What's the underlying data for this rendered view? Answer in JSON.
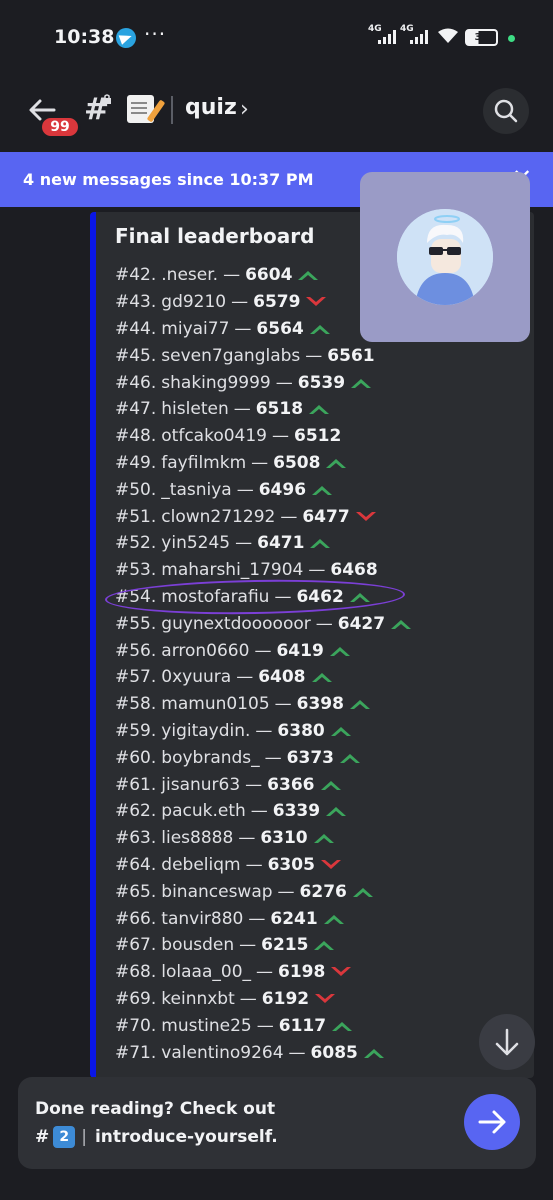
{
  "status_bar": {
    "time": "10:38",
    "dots": "···",
    "net1": "4G",
    "net2": "4G",
    "battery": "39"
  },
  "header": {
    "badge": "99",
    "hash": "#",
    "channel_name": "quiz",
    "chevron": "›"
  },
  "new_messages": {
    "text": "4 new messages since 10:37 PM",
    "close": "✕"
  },
  "embed": {
    "title": "Final leaderboard",
    "rows": [
      {
        "rank": "#42.",
        "name": ".neser.",
        "score": "6604",
        "trend": "up"
      },
      {
        "rank": "#43.",
        "name": "gd9210",
        "score": "6579",
        "trend": "down"
      },
      {
        "rank": "#44.",
        "name": "miyai77",
        "score": "6564",
        "trend": "up"
      },
      {
        "rank": "#45.",
        "name": "seven7ganglabs",
        "score": "6561",
        "trend": ""
      },
      {
        "rank": "#46.",
        "name": "shaking9999",
        "score": "6539",
        "trend": "up"
      },
      {
        "rank": "#47.",
        "name": "hisleten",
        "score": "6518",
        "trend": "up"
      },
      {
        "rank": "#48.",
        "name": "otfcako0419",
        "score": "6512",
        "trend": ""
      },
      {
        "rank": "#49.",
        "name": "fayfilmkm",
        "score": "6508",
        "trend": "up"
      },
      {
        "rank": "#50.",
        "name": "_tasniya",
        "score": "6496",
        "trend": "up"
      },
      {
        "rank": "#51.",
        "name": "clown271292",
        "score": "6477",
        "trend": "down"
      },
      {
        "rank": "#52.",
        "name": "yin5245",
        "score": "6471",
        "trend": "up"
      },
      {
        "rank": "#53.",
        "name": "maharshi_17904",
        "score": "6468",
        "trend": ""
      },
      {
        "rank": "#54.",
        "name": "mostofarafiu",
        "score": "6462",
        "trend": "up"
      },
      {
        "rank": "#55.",
        "name": "guynextdoooooor",
        "score": "6427",
        "trend": "up"
      },
      {
        "rank": "#56.",
        "name": "arron0660",
        "score": "6419",
        "trend": "up"
      },
      {
        "rank": "#57.",
        "name": "0xyuura",
        "score": "6408",
        "trend": "up"
      },
      {
        "rank": "#58.",
        "name": "mamun0105",
        "score": "6398",
        "trend": "up"
      },
      {
        "rank": "#59.",
        "name": "yigitaydin.",
        "score": "6380",
        "trend": "up"
      },
      {
        "rank": "#60.",
        "name": "boybrands_",
        "score": "6373",
        "trend": "up"
      },
      {
        "rank": "#61.",
        "name": "jisanur63",
        "score": "6366",
        "trend": "up"
      },
      {
        "rank": "#62.",
        "name": "pacuk.eth",
        "score": "6339",
        "trend": "up"
      },
      {
        "rank": "#63.",
        "name": "lies8888",
        "score": "6310",
        "trend": "up"
      },
      {
        "rank": "#64.",
        "name": "debeliqm",
        "score": "6305",
        "trend": "down"
      },
      {
        "rank": "#65.",
        "name": "binanceswap",
        "score": "6276",
        "trend": "up"
      },
      {
        "rank": "#66.",
        "name": "tanvir880",
        "score": "6241",
        "trend": "up"
      },
      {
        "rank": "#67.",
        "name": "bousden",
        "score": "6215",
        "trend": "up"
      },
      {
        "rank": "#68.",
        "name": "lolaaa_00_",
        "score": "6198",
        "trend": "down"
      },
      {
        "rank": "#69.",
        "name": "keinnxbt",
        "score": "6192",
        "trend": "down"
      },
      {
        "rank": "#70.",
        "name": "mustine25",
        "score": "6117",
        "trend": "up"
      },
      {
        "rank": "#71.",
        "name": "valentino9264",
        "score": "6085",
        "trend": "up"
      }
    ]
  },
  "cta": {
    "line1": "Done reading? Check out",
    "hash": "#",
    "keycap": "2",
    "separator": "|",
    "channel": "introduce-yourself."
  },
  "colors": {
    "accent": "#5865f2",
    "embed_stripe": "#0a16e6",
    "up": "#3ba55c",
    "down": "#da373c"
  }
}
